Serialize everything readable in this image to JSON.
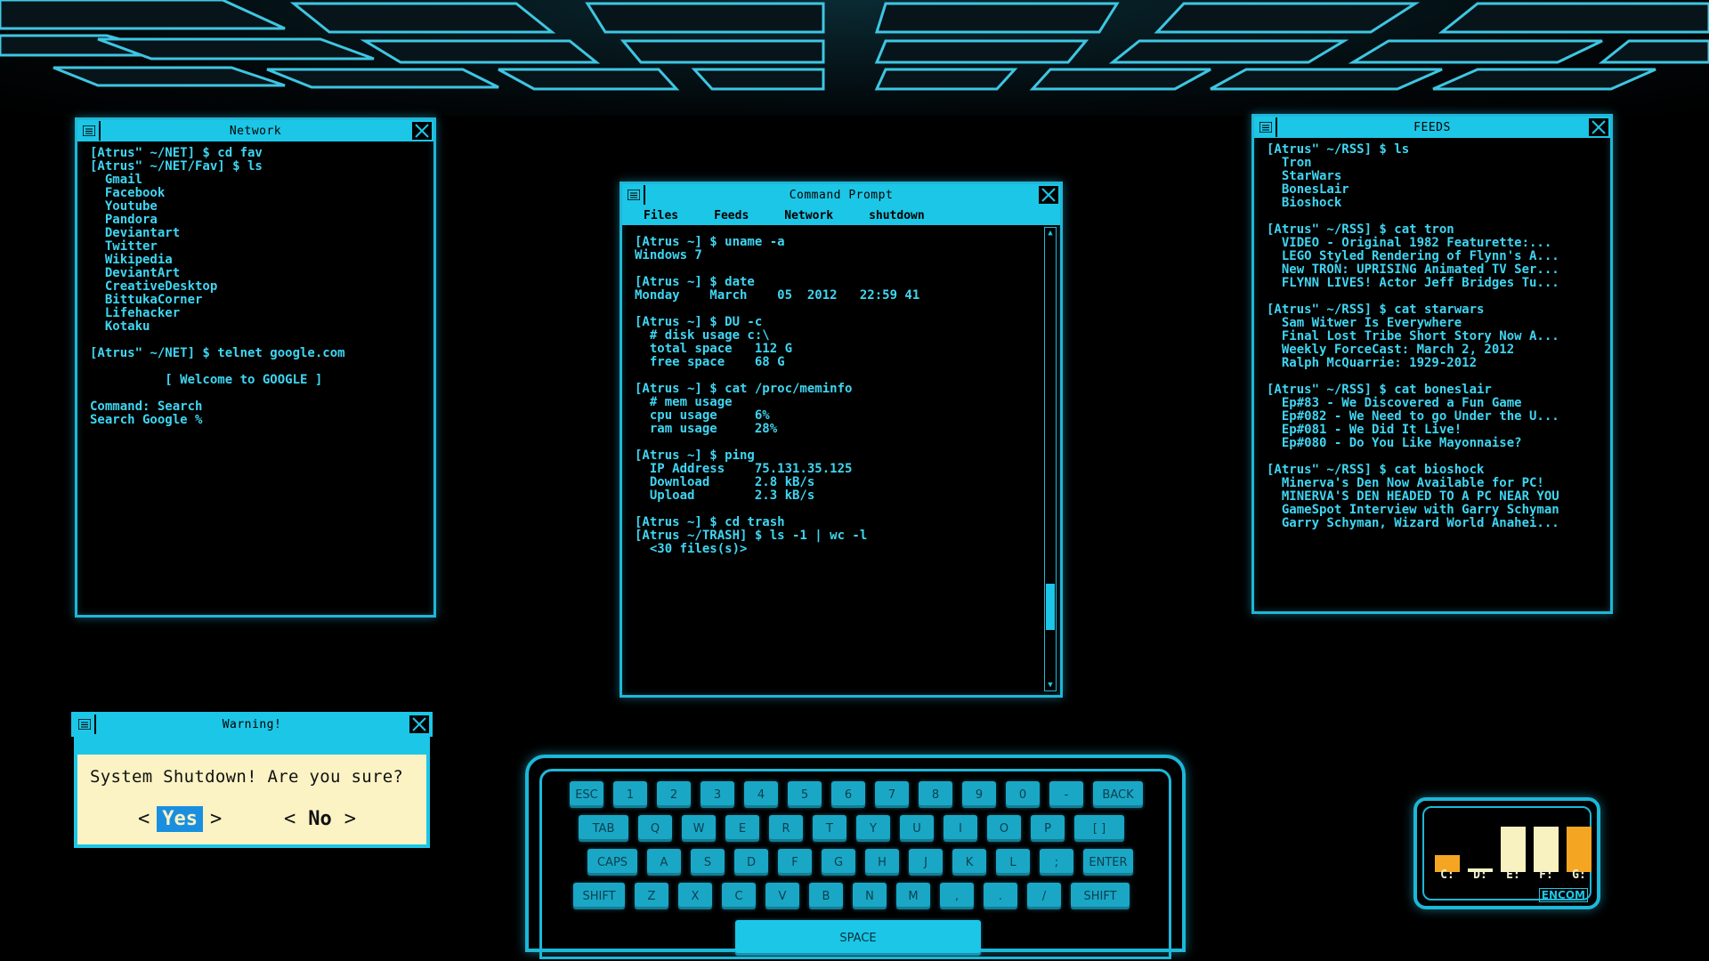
{
  "colors": {
    "accent": "#1cc6e6",
    "text": "#3fd6f2",
    "warning_bg": "#fbf3c4",
    "yes_highlight": "#1a8fe0",
    "drive_orange": "#f4a623",
    "drive_cream": "#f8f1c0"
  },
  "network": {
    "title": "Network",
    "lines": [
      "[Atrus\" ~/NET] $ cd fav",
      "[Atrus\" ~/NET/Fav] $ ls",
      "  Gmail",
      "  Facebook",
      "  Youtube",
      "  Pandora",
      "  Deviantart",
      "  Twitter",
      "  Wikipedia",
      "  DeviantArt",
      "  CreativeDesktop",
      "  BittukaCorner",
      "  Lifehacker",
      "  Kotaku",
      "",
      "[Atrus\" ~/NET] $ telnet google.com",
      "",
      "          [ Welcome to GOOGLE ]",
      "",
      "Command: Search",
      "Search Google %"
    ]
  },
  "command_prompt": {
    "title": "Command Prompt",
    "menu": [
      "Files",
      "Feeds",
      "Network",
      "shutdown"
    ],
    "lines": [
      "[Atrus ~] $ uname -a",
      "Windows 7",
      "",
      "[Atrus ~] $ date",
      "Monday    March    05  2012   22:59 41",
      "",
      "[Atrus ~] $ DU -c",
      "  # disk usage c:\\",
      "  total space   112 G",
      "  free space    68 G",
      "",
      "[Atrus ~] $ cat /proc/meminfo",
      "  # mem usage",
      "  cpu usage     6%",
      "  ram usage     28%",
      "",
      "[Atrus ~] $ ping",
      "  IP Address    75.131.35.125",
      "  Download      2.8 kB/s",
      "  Upload        2.3 kB/s",
      "",
      "[Atrus ~] $ cd trash",
      "[Atrus ~/TRASH] $ ls -1 | wc -l",
      "  <30 files(s)>"
    ]
  },
  "feeds": {
    "title": "FEEDS",
    "lines": [
      "[Atrus\" ~/RSS] $ ls",
      "  Tron",
      "  StarWars",
      "  BonesLair",
      "  Bioshock",
      "",
      "[Atrus\" ~/RSS] $ cat tron",
      "  VIDEO - Original 1982 Featurette:...",
      "  LEGO Styled Rendering of Flynn's A...",
      "  New TRON: UPRISING Animated TV Ser...",
      "  FLYNN LIVES! Actor Jeff Bridges Tu...",
      "",
      "[Atrus\" ~/RSS] $ cat starwars",
      "  Sam Witwer Is Everywhere",
      "  Final Lost Tribe Short Story Now A...",
      "  Weekly ForceCast: March 2, 2012",
      "  Ralph McQuarrie: 1929-2012",
      "",
      "[Atrus\" ~/RSS] $ cat boneslair",
      "  Ep#83 - We Discovered a Fun Game",
      "  Ep#082 - We Need to go Under the U...",
      "  Ep#081 - We Did It Live!",
      "  Ep#080 - Do You Like Mayonnaise?",
      "",
      "[Atrus\" ~/RSS] $ cat bioshock",
      "  Minerva's Den Now Available for PC!",
      "  MINERVA'S DEN HEADED TO A PC NEAR YOU",
      "  GameSpot Interview with Garry Schyman",
      "  Garry Schyman, Wizard World Anahei..."
    ]
  },
  "warning": {
    "title": "Warning!",
    "message": "System Shutdown! Are you sure?",
    "yes": "Yes",
    "no": "No",
    "left_arrow": "<",
    "right_arrow": ">"
  },
  "keyboard": {
    "rows": [
      [
        "ESC",
        "1",
        "2",
        "3",
        "4",
        "5",
        "6",
        "7",
        "8",
        "9",
        "0",
        "-",
        "BACK"
      ],
      [
        "TAB",
        "Q",
        "W",
        "E",
        "R",
        "T",
        "Y",
        "U",
        "I",
        "O",
        "P",
        "[ ]"
      ],
      [
        "CAPS",
        "A",
        "S",
        "D",
        "F",
        "G",
        "H",
        "J",
        "K",
        "L",
        ";",
        "ENTER"
      ],
      [
        "SHIFT",
        "Z",
        "X",
        "C",
        "V",
        "B",
        "N",
        "M",
        ",",
        ".",
        "/",
        "SHIFT"
      ]
    ],
    "space": "SPACE"
  },
  "drives": {
    "items": [
      {
        "label": "C:",
        "level": 0.3,
        "color": "#f4a623"
      },
      {
        "label": "D:",
        "level": 0.06,
        "color": "#f8f1c0"
      },
      {
        "label": "E:",
        "level": 0.82,
        "color": "#f8f1c0"
      },
      {
        "label": "F:",
        "level": 0.82,
        "color": "#f8f1c0"
      },
      {
        "label": "G:",
        "level": 0.82,
        "color": "#f4a623"
      }
    ],
    "brand": "ENCOM"
  }
}
